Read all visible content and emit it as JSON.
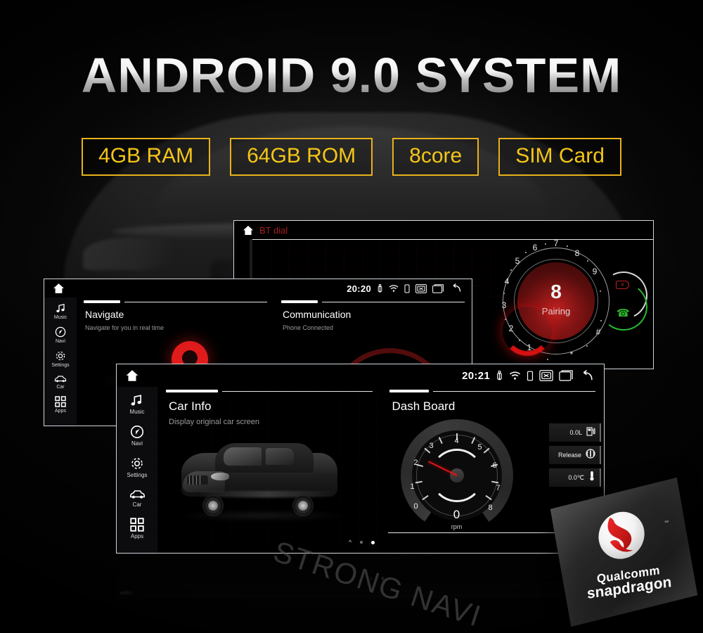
{
  "headline": "ANDROID 9.0 SYSTEM",
  "specs": [
    {
      "label": "4GB RAM"
    },
    {
      "label": "64GB ROM"
    },
    {
      "label": "8core"
    },
    {
      "label": "SIM Card"
    }
  ],
  "colors": {
    "accent_yellow": "#f5c518",
    "chip_border": "#e8b11c",
    "ui_red": "#c02020",
    "call_green": "#2eb82e",
    "needle_red": "#e01414",
    "screen_border": "#cfd6dc"
  },
  "bt_screen": {
    "home_icon": "home-icon",
    "title": "BT dial",
    "dial": {
      "digit": "8",
      "state": "Pairing",
      "keys": [
        "1",
        "2",
        "3",
        "4",
        "5",
        "6",
        "7",
        "8",
        "9",
        "*",
        "#"
      ],
      "hangup_icon": "hangup-icon",
      "call_icon": "call-icon"
    }
  },
  "mid_screen": {
    "statusbar": {
      "clock": "20:20",
      "icons": [
        "usb-icon",
        "wifi-icon",
        "phone-icon",
        "x-box-icon",
        "window-icon",
        "back-icon"
      ]
    },
    "sidebar": [
      {
        "label": "Music",
        "icon": "music-note-icon"
      },
      {
        "label": "Navi",
        "icon": "navigation-icon"
      },
      {
        "label": "Settings",
        "icon": "gear-icon"
      },
      {
        "label": "Car",
        "icon": "car-icon"
      },
      {
        "label": "Apps",
        "icon": "apps-grid-icon"
      }
    ],
    "panes": [
      {
        "title": "Navigate",
        "subtitle": "Navigate for you in real time",
        "art": "map-pin"
      },
      {
        "title": "Communication",
        "subtitle": "Phone Connected",
        "art": "signal-waves"
      }
    ]
  },
  "bottom_screen": {
    "statusbar": {
      "clock": "20:21",
      "icons": [
        "usb-icon",
        "wifi-icon",
        "phone-icon",
        "x-box-icon",
        "window-icon",
        "back-icon"
      ]
    },
    "sidebar": [
      {
        "label": "Music",
        "icon": "music-note-icon"
      },
      {
        "label": "Navi",
        "icon": "navigation-icon"
      },
      {
        "label": "Settings",
        "icon": "gear-icon"
      },
      {
        "label": "Car",
        "icon": "car-icon"
      },
      {
        "label": "Apps",
        "icon": "apps-grid-icon"
      }
    ],
    "panes": [
      {
        "title": "Car Info",
        "subtitle": "Display original car screen",
        "art": "bmw-x5-photo"
      },
      {
        "title": "Dash Board",
        "subtitle": "",
        "art": "tachometer"
      }
    ],
    "dashboard": {
      "rpm_value": "0",
      "rpm_unit": "rpm",
      "tick_labels": [
        "0",
        "1",
        "2",
        "3",
        "4",
        "5",
        "6",
        "7",
        "8"
      ],
      "info_rows": [
        {
          "value": "0.0L",
          "icon": "fuel-pump-icon"
        },
        {
          "value": "Release",
          "icon": "parking-brake-icon"
        },
        {
          "value": "0.0℃",
          "icon": "thermometer-icon"
        }
      ]
    },
    "page_dots": {
      "count": 3,
      "active_index": 2
    }
  },
  "watermark": "STRONG NAVI",
  "snapdragon": {
    "line1": "Qualcomm",
    "line2": "snapdragon",
    "trademark": "™",
    "logo_icon": "snapdragon-s-logo-icon"
  },
  "reflection": {
    "label": "Apps"
  }
}
